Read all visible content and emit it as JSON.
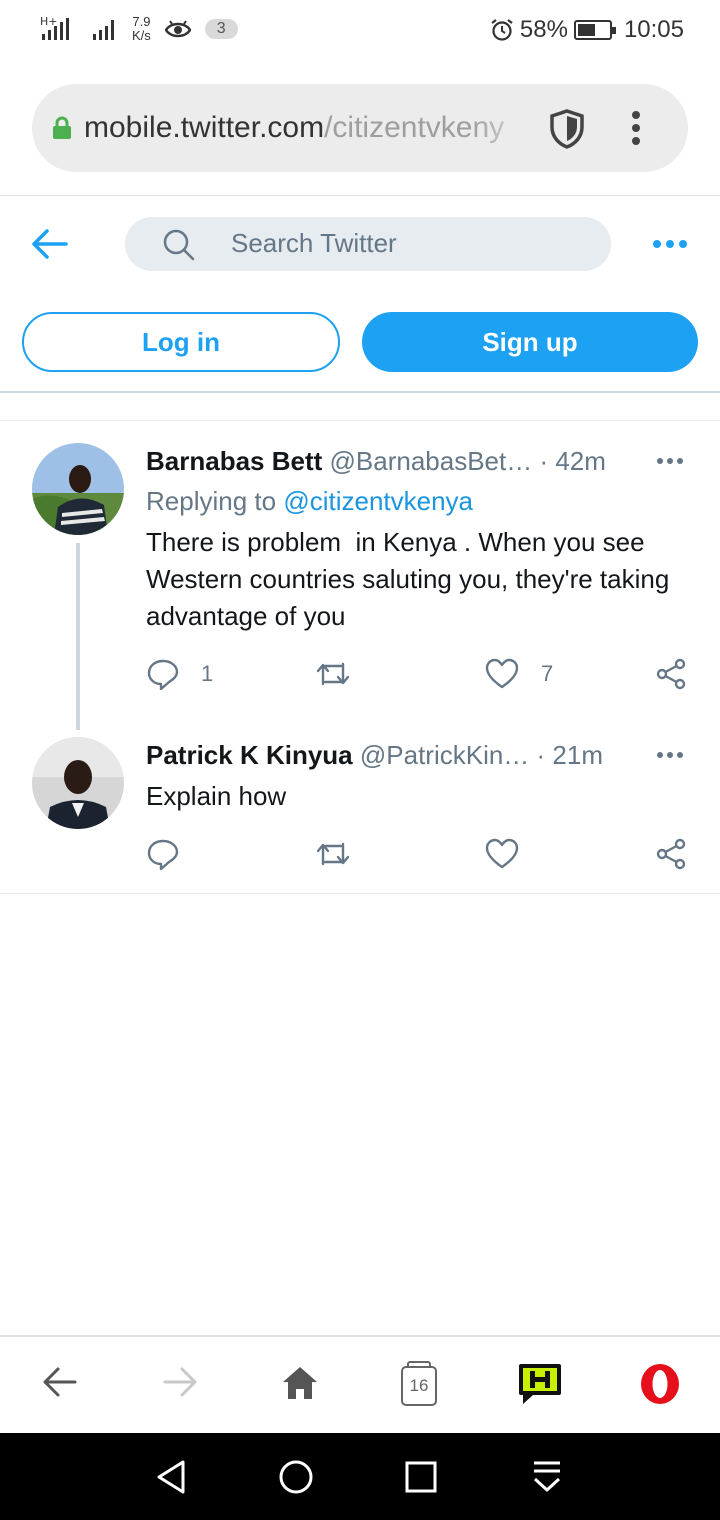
{
  "status_bar": {
    "network_left": "H+",
    "network_speed_value": "7.9",
    "network_speed_unit": "K/s",
    "notification_count": "3",
    "battery": "58%",
    "time": "10:05",
    "battery_level_percent": 58
  },
  "browser": {
    "url_host": "mobile.twitter.com",
    "url_path": "/citizentvkeny",
    "tab_count": "16"
  },
  "twitter": {
    "search_placeholder": "Search Twitter",
    "login_label": "Log in",
    "signup_label": "Sign up",
    "accent_color": "#1da1f2"
  },
  "tweets": [
    {
      "name": "Barnabas Bett",
      "handle": "@BarnabasBet…",
      "time": "· 42m",
      "replying_prefix": "Replying to ",
      "replying_to": "@citizentvkenya",
      "text": "There is problem  in Kenya . When you see Western countries saluting you, they're taking advantage of you",
      "reply_count": "1",
      "retweet_count": "",
      "like_count": "7"
    },
    {
      "name": "Patrick K Kinyua",
      "handle": "@PatrickKin…",
      "time": "· 21m",
      "text": "Explain how",
      "reply_count": "",
      "retweet_count": "",
      "like_count": ""
    }
  ]
}
